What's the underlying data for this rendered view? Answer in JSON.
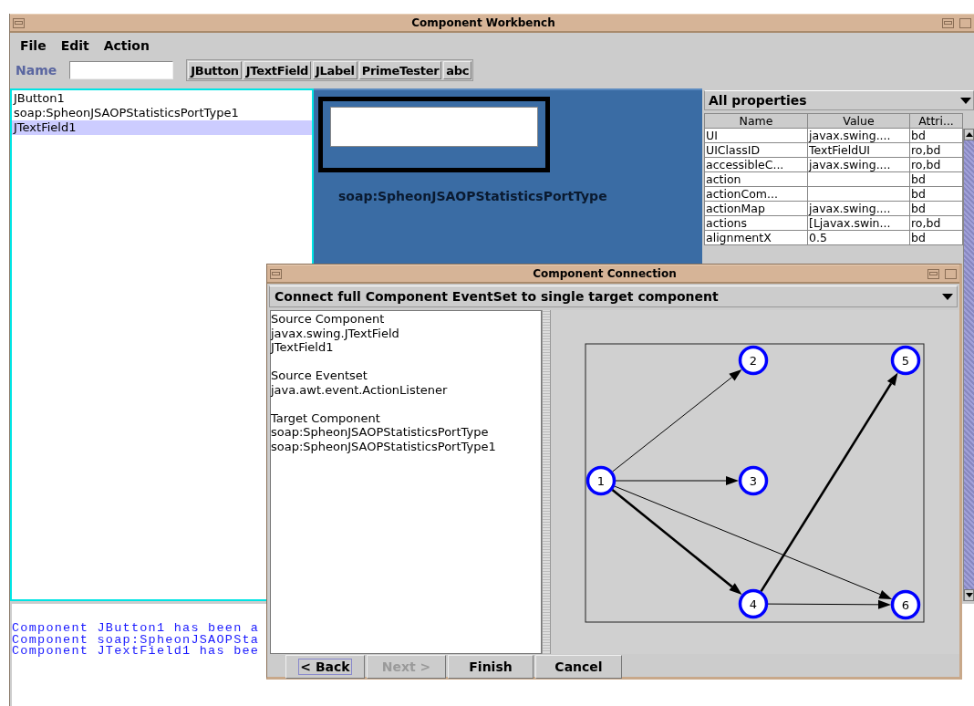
{
  "window": {
    "title": "Component Workbench"
  },
  "menu": [
    "File",
    "Edit",
    "Action"
  ],
  "toolbar": {
    "name_label": "Name",
    "palette": [
      "JButton",
      "JTextField",
      "JLabel",
      "PrimeTester",
      "abc"
    ]
  },
  "components": [
    {
      "label": "JButton1",
      "selected": false
    },
    {
      "label": "soap:SpheonJSAOPStatisticsPortType1",
      "selected": false
    },
    {
      "label": "JTextField1",
      "selected": true
    }
  ],
  "design": {
    "label": "soap:SpheonJSAOPStatisticsPortType"
  },
  "properties": {
    "filter": "All properties",
    "columns": [
      "Name",
      "Value",
      "Attri..."
    ],
    "rows": [
      {
        "name": "UI",
        "value": "javax.swing....",
        "attributes": "bd"
      },
      {
        "name": "UIClassID",
        "value": "TextFieldUI",
        "attributes": "ro,bd"
      },
      {
        "name": "accessibleC...",
        "value": "javax.swing....",
        "attributes": "ro,bd"
      },
      {
        "name": "action",
        "attributes": "bd"
      },
      {
        "name": "actionCom...",
        "attributes": "bd"
      },
      {
        "name": "actionMap",
        "value": "javax.swing....",
        "attributes": "bd"
      },
      {
        "name": "actions",
        "value": "[Ljavax.swin...",
        "attributes": "ro,bd"
      },
      {
        "name": "alignmentX",
        "value": "0.5",
        "attributes": "bd"
      }
    ]
  },
  "log": [
    "Component JButton1 has been a",
    "Component soap:SpheonJSAOPSta",
    "Component JTextField1 has bee"
  ],
  "dialog": {
    "title": "Component Connection",
    "mode": "Connect full Component EventSet to single target component",
    "summary": [
      {
        "heading": "Source Component",
        "lines": [
          "javax.swing.JTextField",
          "JTextField1"
        ]
      },
      {
        "heading": "Source Eventset",
        "lines": [
          "java.awt.event.ActionListener"
        ]
      },
      {
        "heading": "Target Component",
        "lines": [
          "soap:SpheonJSAOPStatisticsPortType",
          "soap:SpheonJSAOPStatisticsPortType1"
        ]
      }
    ],
    "graph": {
      "nodes": [
        {
          "label": "1"
        },
        {
          "label": "2"
        },
        {
          "label": "3"
        },
        {
          "label": "4"
        },
        {
          "label": "5"
        },
        {
          "label": "6"
        }
      ]
    },
    "buttons": [
      {
        "label": "< Back",
        "disabled": false,
        "focused": true
      },
      {
        "label": "Next >",
        "disabled": true,
        "focused": false
      },
      {
        "label": "Finish",
        "disabled": false,
        "focused": false
      },
      {
        "label": "Cancel",
        "disabled": false,
        "focused": false
      }
    ]
  }
}
